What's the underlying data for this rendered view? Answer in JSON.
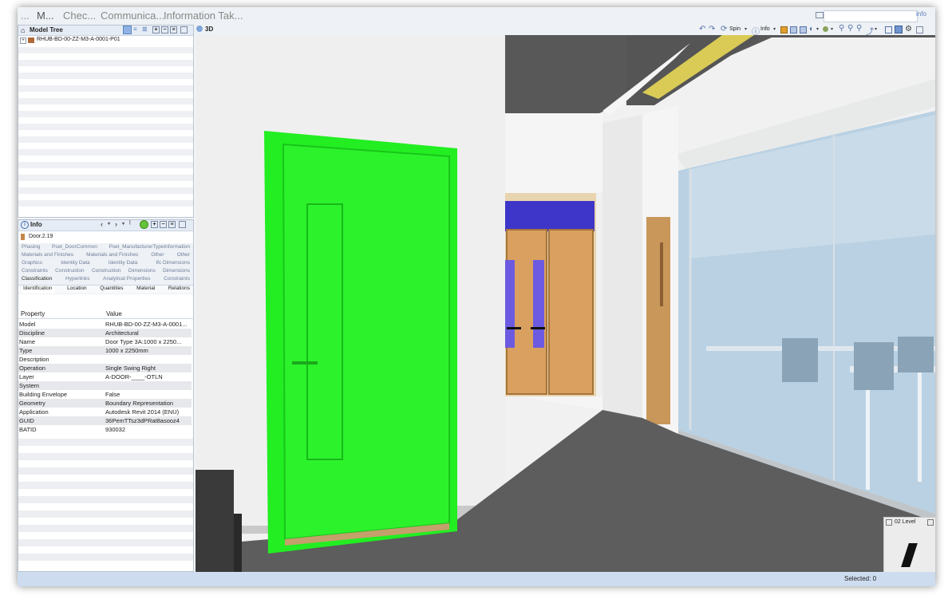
{
  "menu": {
    "items": [
      "...",
      "M...",
      "Chec...",
      "Communica...",
      "Information Tak..."
    ]
  },
  "search": {
    "value": "",
    "help_label": "info"
  },
  "model_tree": {
    "title": "Model Tree",
    "root_item": "RHUB-BD-00-ZZ-M3-A-0001-P01"
  },
  "info_panel": {
    "title": "Info",
    "object_name": "Door.2.19",
    "tab_rows": [
      [
        "Phasing",
        "Pset_DoorCommon",
        "Pset_ManufacturerTypeInformation"
      ],
      [
        "Materials and Finishes",
        "Materials and Finishes",
        "Other",
        "Other"
      ],
      [
        "Graphics",
        "Identity Data",
        "Identity Data",
        "Ifc Dimensions"
      ],
      [
        "Constraints",
        "Construction",
        "Construction",
        "Dimensions",
        "Dimensions"
      ],
      [
        "Classification",
        "Hyperlinks",
        "Analytical Properties",
        "Constraints"
      ],
      [
        "Identification",
        "Location",
        "Quantities",
        "Material",
        "Relations"
      ]
    ],
    "columns": {
      "property": "Property",
      "value": "Value"
    },
    "properties": [
      {
        "property": "Model",
        "value": "RHUB-BD-00-ZZ-M3-A-0001..."
      },
      {
        "property": "Discipline",
        "value": "Architectural"
      },
      {
        "property": "Name",
        "value": "Door Type 3A:1000 x 2250..."
      },
      {
        "property": "Type",
        "value": "1000 x 2250mm"
      },
      {
        "property": "Description",
        "value": ""
      },
      {
        "property": "Operation",
        "value": "Single Swing Right"
      },
      {
        "property": "Layer",
        "value": "A-DOOR-____-OTLN"
      },
      {
        "property": "System",
        "value": ""
      },
      {
        "property": "Building Envelope",
        "value": "False"
      },
      {
        "property": "Geometry",
        "value": "Boundary Representation"
      },
      {
        "property": "Application",
        "value": "Autodesk Revit 2014 (ENU)"
      },
      {
        "property": "GUID",
        "value": "36PemTTsz3dPRat8asooz4"
      },
      {
        "property": "BATID",
        "value": "930032"
      }
    ]
  },
  "viewer": {
    "title": "3D",
    "spin_label": "Spin",
    "info_label": "Info",
    "level_label": "02 Level"
  },
  "status": {
    "selected": "Selected: 0"
  },
  "colors": {
    "selection": "#22ee22",
    "door_wood": "#d6a060",
    "glass": "#b6d2e2",
    "floor": "#5d5d5d"
  }
}
